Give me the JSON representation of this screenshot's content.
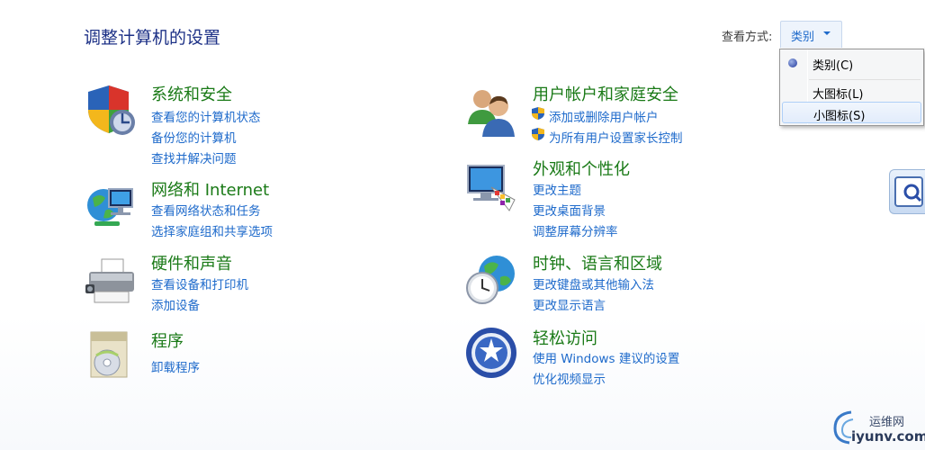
{
  "page_title": "调整计算机的设置",
  "view_by": {
    "label": "查看方式:",
    "current": "类别",
    "options": [
      "类别(C)",
      "大图标(L)",
      "小图标(S)"
    ]
  },
  "categories": [
    {
      "title": "系统和安全",
      "links": [
        "查看您的计算机状态",
        "备份您的计算机",
        "查找并解决问题"
      ]
    },
    {
      "title": "网络和 Internet",
      "links": [
        "查看网络状态和任务",
        "选择家庭组和共享选项"
      ]
    },
    {
      "title": "硬件和声音",
      "links": [
        "查看设备和打印机",
        "添加设备"
      ]
    },
    {
      "title": "程序",
      "links": [
        "卸载程序"
      ]
    },
    {
      "title": "用户帐户和家庭安全",
      "links": [
        "添加或删除用户帐户",
        "为所有用户设置家长控制"
      ]
    },
    {
      "title": "外观和个性化",
      "links": [
        "更改主题",
        "更改桌面背景",
        "调整屏幕分辨率"
      ]
    },
    {
      "title": "时钟、语言和区域",
      "links": [
        "更改键盘或其他输入法",
        "更改显示语言"
      ]
    },
    {
      "title": "轻松访问",
      "links": [
        "使用 Windows 建议的设置",
        "优化视频显示"
      ]
    }
  ],
  "watermark": {
    "cn": "运维网",
    "en": "iyunv.com"
  }
}
